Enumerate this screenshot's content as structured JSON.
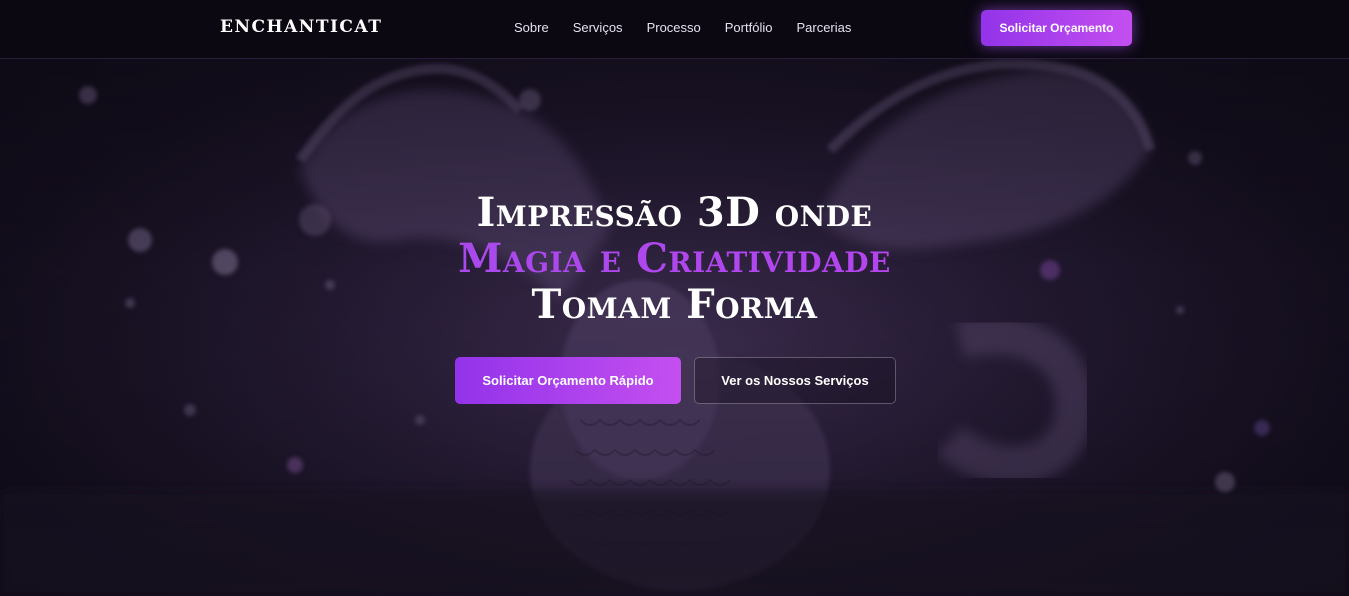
{
  "brand": {
    "logo_text": "ENCHANTICAT"
  },
  "nav": {
    "links": [
      "Sobre",
      "Serviços",
      "Processo",
      "Portfólio",
      "Parcerias"
    ],
    "cta_label": "Solicitar Orçamento"
  },
  "hero": {
    "headline_line1": "Impressão 3D onde",
    "headline_line2": "Magia e Criatividade",
    "headline_line3": "Tomam Forma",
    "primary_button": "Solicitar Orçamento Rápido",
    "secondary_button": "Ver os Nossos Serviços",
    "background_image": "purple-dragon-figurine-3d-print"
  },
  "colors": {
    "accent": "#a855f7",
    "accent_gradient_end": "#c44ff0",
    "background": "#0d0a14"
  }
}
